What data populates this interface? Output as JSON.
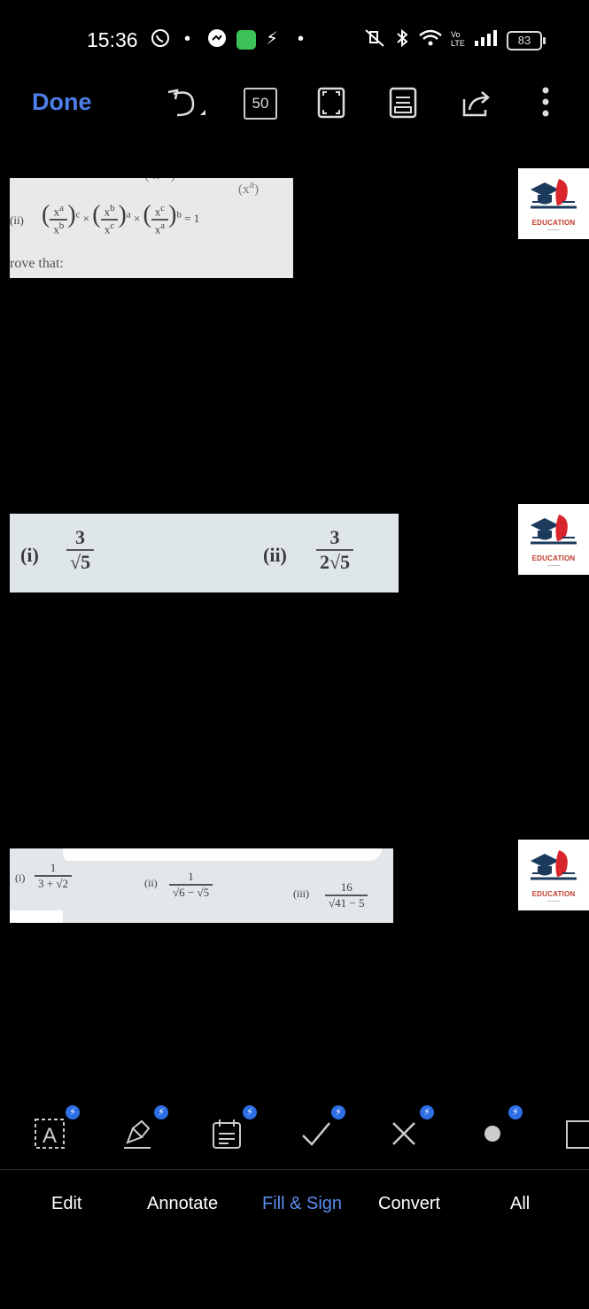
{
  "status_bar": {
    "time": "15:36",
    "battery": "83",
    "signal_label": "Vo LTE"
  },
  "toolbar": {
    "done_label": "Done",
    "page_count": "50"
  },
  "document": {
    "snippet1": {
      "item_label": "(ii)",
      "result": "= 1",
      "text_line": "rove that:",
      "fragment_top": "(x",
      "fragment_top_exp": "a"
    },
    "snippet2": {
      "i_label": "(i)",
      "i_num": "3",
      "i_den": "√5",
      "ii_label": "(ii)",
      "ii_num": "3",
      "ii_den": "2√5"
    },
    "snippet3": {
      "i_label": "(i)",
      "i_num": "1",
      "i_den": "3 + √2",
      "ii_label": "(ii)",
      "ii_num": "1",
      "ii_den": "√6 − √5",
      "iii_label": "(iii)",
      "iii_num": "16",
      "iii_den": "√41 − 5"
    },
    "logo_text": "EDUCATION"
  },
  "bottom_tabs": {
    "edit": "Edit",
    "annotate": "Annotate",
    "fill_sign": "Fill & Sign",
    "convert": "Convert",
    "all": "All"
  },
  "colors": {
    "accent": "#5b8ef0",
    "done": "#4d7fe8",
    "badge": "#2f6fe6"
  }
}
